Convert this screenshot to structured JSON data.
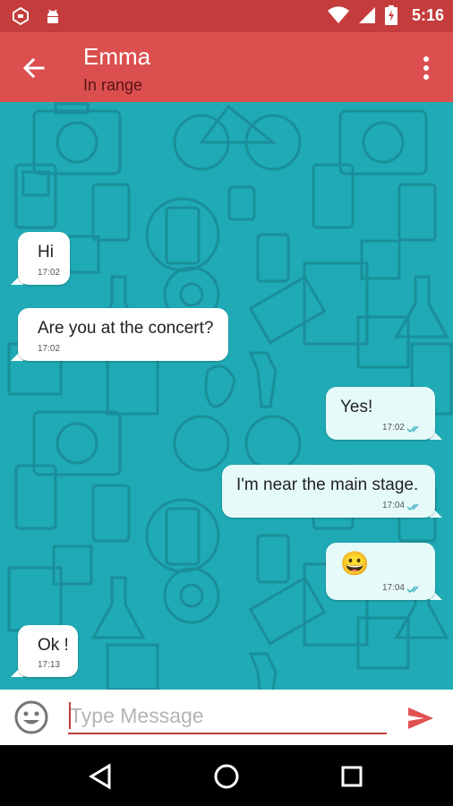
{
  "status_bar": {
    "time": "5:16",
    "icons": [
      "hangouts-icon",
      "android-debug-icon",
      "wifi-icon",
      "cell-signal-icon",
      "battery-charging-icon"
    ]
  },
  "header": {
    "contact_name": "Emma",
    "status": "In range",
    "icons": [
      "back-arrow-icon",
      "more-vert-icon"
    ]
  },
  "messages": [
    {
      "direction": "in",
      "text": "Hi",
      "time": "17:02"
    },
    {
      "direction": "in",
      "text": "Are you at the concert?",
      "time": "17:02"
    },
    {
      "direction": "out",
      "text": "Yes!",
      "time": "17:02",
      "status": "read"
    },
    {
      "direction": "out",
      "text": "I'm near the main stage.",
      "time": "17:04",
      "status": "read"
    },
    {
      "direction": "out",
      "text": "😀",
      "time": "17:04",
      "status": "read"
    },
    {
      "direction": "in",
      "text": "Ok !",
      "time": "17:13"
    }
  ],
  "composer": {
    "placeholder": "Type Message",
    "value": "",
    "icons": [
      "emoji-icon",
      "send-icon"
    ]
  },
  "nav_bar": {
    "icons": [
      "back-triangle-icon",
      "home-circle-icon",
      "recents-square-icon"
    ]
  },
  "colors": {
    "status_bar": "#c43c3c",
    "app_bar": "#db4f4f",
    "chat_background": "#1faab5",
    "outgoing_bubble": "#e6fbf9",
    "incoming_bubble": "#ffffff",
    "accent": "#e05252",
    "read_ticks": "#3ab0c4"
  }
}
